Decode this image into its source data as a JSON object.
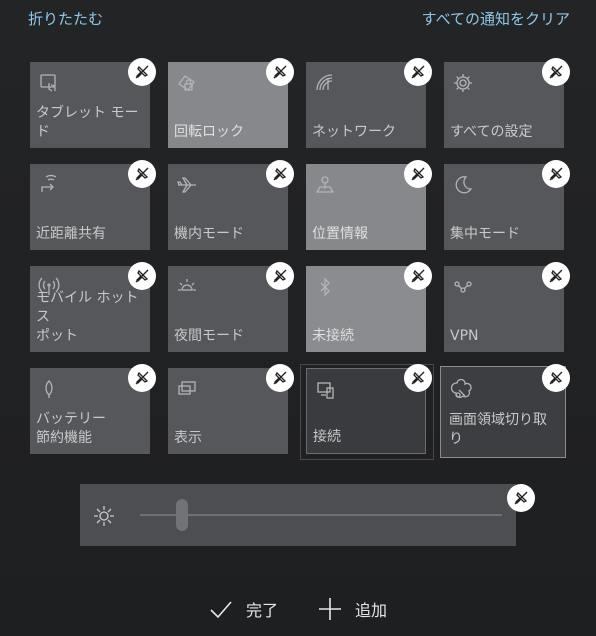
{
  "header": {
    "collapse_label": "折りたたむ",
    "clear_all_label": "すべての通知をクリア"
  },
  "tiles": [
    {
      "label": "タブレット モード"
    },
    {
      "label": "回転ロック"
    },
    {
      "label": "ネットワーク"
    },
    {
      "label": "すべての設定"
    },
    {
      "label": "近距離共有"
    },
    {
      "label": "機内モード"
    },
    {
      "label": "位置情報"
    },
    {
      "label": "集中モード"
    },
    {
      "label": "モバイル ホットス\nポット"
    },
    {
      "label": "夜間モード"
    },
    {
      "label": "未接続"
    },
    {
      "label": "VPN"
    },
    {
      "label": "バッテリー\n節約機能"
    },
    {
      "label": "表示"
    },
    {
      "label": "接続"
    },
    {
      "label": "画面領域切り取\nり"
    }
  ],
  "bottom": {
    "done_label": "完了",
    "add_label": "追加"
  },
  "colors": {
    "accent_link": "#8fc8ea",
    "tile": "#56575a",
    "tile_light": "#87888b",
    "background": "#1f2022"
  }
}
